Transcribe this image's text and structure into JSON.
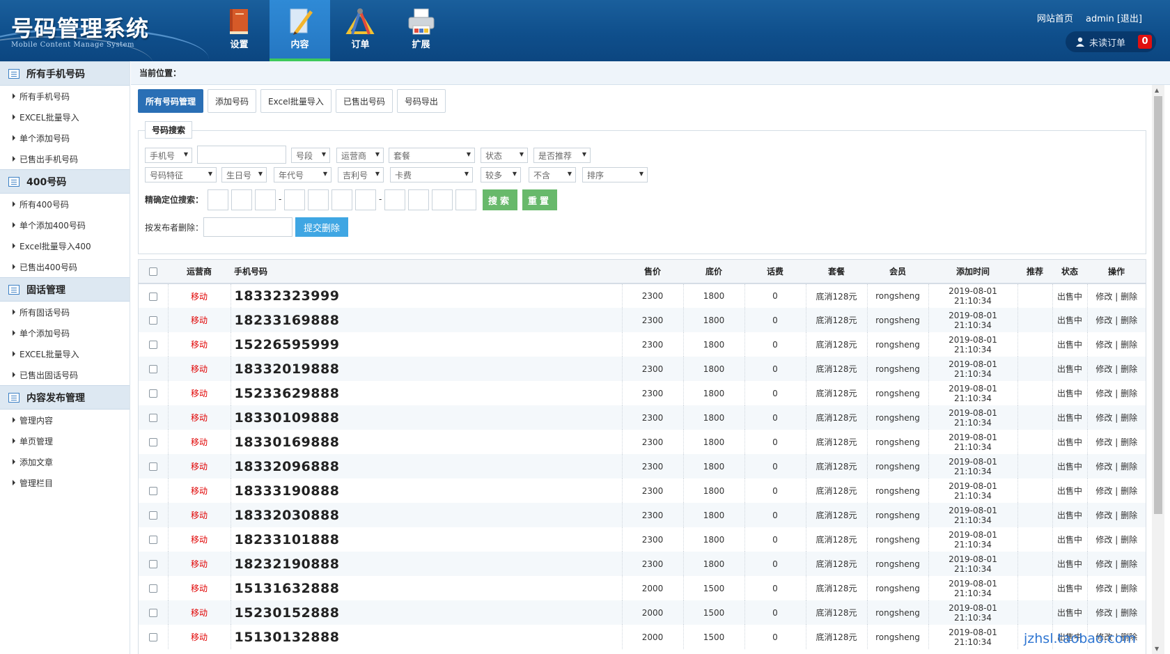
{
  "header": {
    "logo_title": "号码管理系统",
    "logo_subtitle": "Mobile Content Manage System",
    "nav": [
      {
        "label": "设置",
        "icon": "book-icon"
      },
      {
        "label": "内容",
        "icon": "pencil-ruler-icon",
        "active": true
      },
      {
        "label": "订单",
        "icon": "compass-icon"
      },
      {
        "label": "扩展",
        "icon": "printer-icon"
      }
    ],
    "links": {
      "home": "网站首页",
      "user": "admin [退出]"
    },
    "unread": {
      "label": "未读订单",
      "count": "0"
    }
  },
  "sidebar": {
    "sections": [
      {
        "title": "所有手机号码",
        "items": [
          "所有手机号码",
          "EXCEL批量导入",
          "单个添加号码",
          "已售出手机号码"
        ]
      },
      {
        "title": "400号码",
        "items": [
          "所有400号码",
          "单个添加400号码",
          "Excel批量导入400",
          "已售出400号码"
        ]
      },
      {
        "title": "固话管理",
        "items": [
          "所有固话号码",
          "单个添加号码",
          "EXCEL批量导入",
          "已售出固话号码"
        ]
      },
      {
        "title": "内容发布管理",
        "items": [
          "管理内容",
          "单页管理",
          "添加文章",
          "管理栏目"
        ]
      }
    ]
  },
  "breadcrumb": "当前位置：",
  "tabs": [
    "所有号码管理",
    "添加号码",
    "Excel批量导入",
    "已售出号码",
    "号码导出"
  ],
  "search": {
    "legend": "号码搜索",
    "row1": [
      "手机号",
      "号段",
      "运营商",
      "套餐",
      "状态",
      "是否推荐"
    ],
    "row2": [
      "号码特征",
      "生日号",
      "年代号",
      "吉利号",
      "卡费",
      "较多",
      "不含",
      "排序"
    ],
    "precise_label": "精确定位搜索：",
    "search_btn": "搜索",
    "reset_btn": "重置",
    "delete_label": "按发布者删除：",
    "delete_btn": "提交删除"
  },
  "table": {
    "headers": [
      "运营商",
      "手机号码",
      "售价",
      "底价",
      "话费",
      "套餐",
      "会员",
      "添加时间",
      "推荐",
      "状态",
      "操作"
    ],
    "rows": [
      {
        "op": "移动",
        "number": "18332323999",
        "price": "2300",
        "base": "1800",
        "fee": "0",
        "plan": "底消128元",
        "member": "rongsheng",
        "time": "2019-08-01 21:10:34",
        "rec": "",
        "status": "出售中",
        "action": "修改 | 删除"
      },
      {
        "op": "移动",
        "number": "18233169888",
        "price": "2300",
        "base": "1800",
        "fee": "0",
        "plan": "底消128元",
        "member": "rongsheng",
        "time": "2019-08-01 21:10:34",
        "rec": "",
        "status": "出售中",
        "action": "修改 | 删除"
      },
      {
        "op": "移动",
        "number": "15226595999",
        "price": "2300",
        "base": "1800",
        "fee": "0",
        "plan": "底消128元",
        "member": "rongsheng",
        "time": "2019-08-01 21:10:34",
        "rec": "",
        "status": "出售中",
        "action": "修改 | 删除"
      },
      {
        "op": "移动",
        "number": "18332019888",
        "price": "2300",
        "base": "1800",
        "fee": "0",
        "plan": "底消128元",
        "member": "rongsheng",
        "time": "2019-08-01 21:10:34",
        "rec": "",
        "status": "出售中",
        "action": "修改 | 删除"
      },
      {
        "op": "移动",
        "number": "15233629888",
        "price": "2300",
        "base": "1800",
        "fee": "0",
        "plan": "底消128元",
        "member": "rongsheng",
        "time": "2019-08-01 21:10:34",
        "rec": "",
        "status": "出售中",
        "action": "修改 | 删除"
      },
      {
        "op": "移动",
        "number": "18330109888",
        "price": "2300",
        "base": "1800",
        "fee": "0",
        "plan": "底消128元",
        "member": "rongsheng",
        "time": "2019-08-01 21:10:34",
        "rec": "",
        "status": "出售中",
        "action": "修改 | 删除"
      },
      {
        "op": "移动",
        "number": "18330169888",
        "price": "2300",
        "base": "1800",
        "fee": "0",
        "plan": "底消128元",
        "member": "rongsheng",
        "time": "2019-08-01 21:10:34",
        "rec": "",
        "status": "出售中",
        "action": "修改 | 删除"
      },
      {
        "op": "移动",
        "number": "18332096888",
        "price": "2300",
        "base": "1800",
        "fee": "0",
        "plan": "底消128元",
        "member": "rongsheng",
        "time": "2019-08-01 21:10:34",
        "rec": "",
        "status": "出售中",
        "action": "修改 | 删除"
      },
      {
        "op": "移动",
        "number": "18333190888",
        "price": "2300",
        "base": "1800",
        "fee": "0",
        "plan": "底消128元",
        "member": "rongsheng",
        "time": "2019-08-01 21:10:34",
        "rec": "",
        "status": "出售中",
        "action": "修改 | 删除"
      },
      {
        "op": "移动",
        "number": "18332030888",
        "price": "2300",
        "base": "1800",
        "fee": "0",
        "plan": "底消128元",
        "member": "rongsheng",
        "time": "2019-08-01 21:10:34",
        "rec": "",
        "status": "出售中",
        "action": "修改 | 删除"
      },
      {
        "op": "移动",
        "number": "18233101888",
        "price": "2300",
        "base": "1800",
        "fee": "0",
        "plan": "底消128元",
        "member": "rongsheng",
        "time": "2019-08-01 21:10:34",
        "rec": "",
        "status": "出售中",
        "action": "修改 | 删除"
      },
      {
        "op": "移动",
        "number": "18232190888",
        "price": "2300",
        "base": "1800",
        "fee": "0",
        "plan": "底消128元",
        "member": "rongsheng",
        "time": "2019-08-01 21:10:34",
        "rec": "",
        "status": "出售中",
        "action": "修改 | 删除"
      },
      {
        "op": "移动",
        "number": "15131632888",
        "price": "2000",
        "base": "1500",
        "fee": "0",
        "plan": "底消128元",
        "member": "rongsheng",
        "time": "2019-08-01 21:10:34",
        "rec": "",
        "status": "出售中",
        "action": "修改 | 删除"
      },
      {
        "op": "移动",
        "number": "15230152888",
        "price": "2000",
        "base": "1500",
        "fee": "0",
        "plan": "底消128元",
        "member": "rongsheng",
        "time": "2019-08-01 21:10:34",
        "rec": "",
        "status": "出售中",
        "action": "修改 | 删除"
      },
      {
        "op": "移动",
        "number": "15130132888",
        "price": "2000",
        "base": "1500",
        "fee": "0",
        "plan": "底消128元",
        "member": "rongsheng",
        "time": "2019-08-01 21:10:34",
        "rec": "",
        "status": "出售中",
        "action": "修改 | 删除"
      }
    ]
  },
  "watermark": "jzhsl.taobao.com",
  "colors": {
    "header": "#0f4f8c",
    "active_tab": "#2a6fb5",
    "operator_text": "#e00000",
    "search_btn": "#68b96b",
    "delete_btn": "#3fa6e3"
  }
}
